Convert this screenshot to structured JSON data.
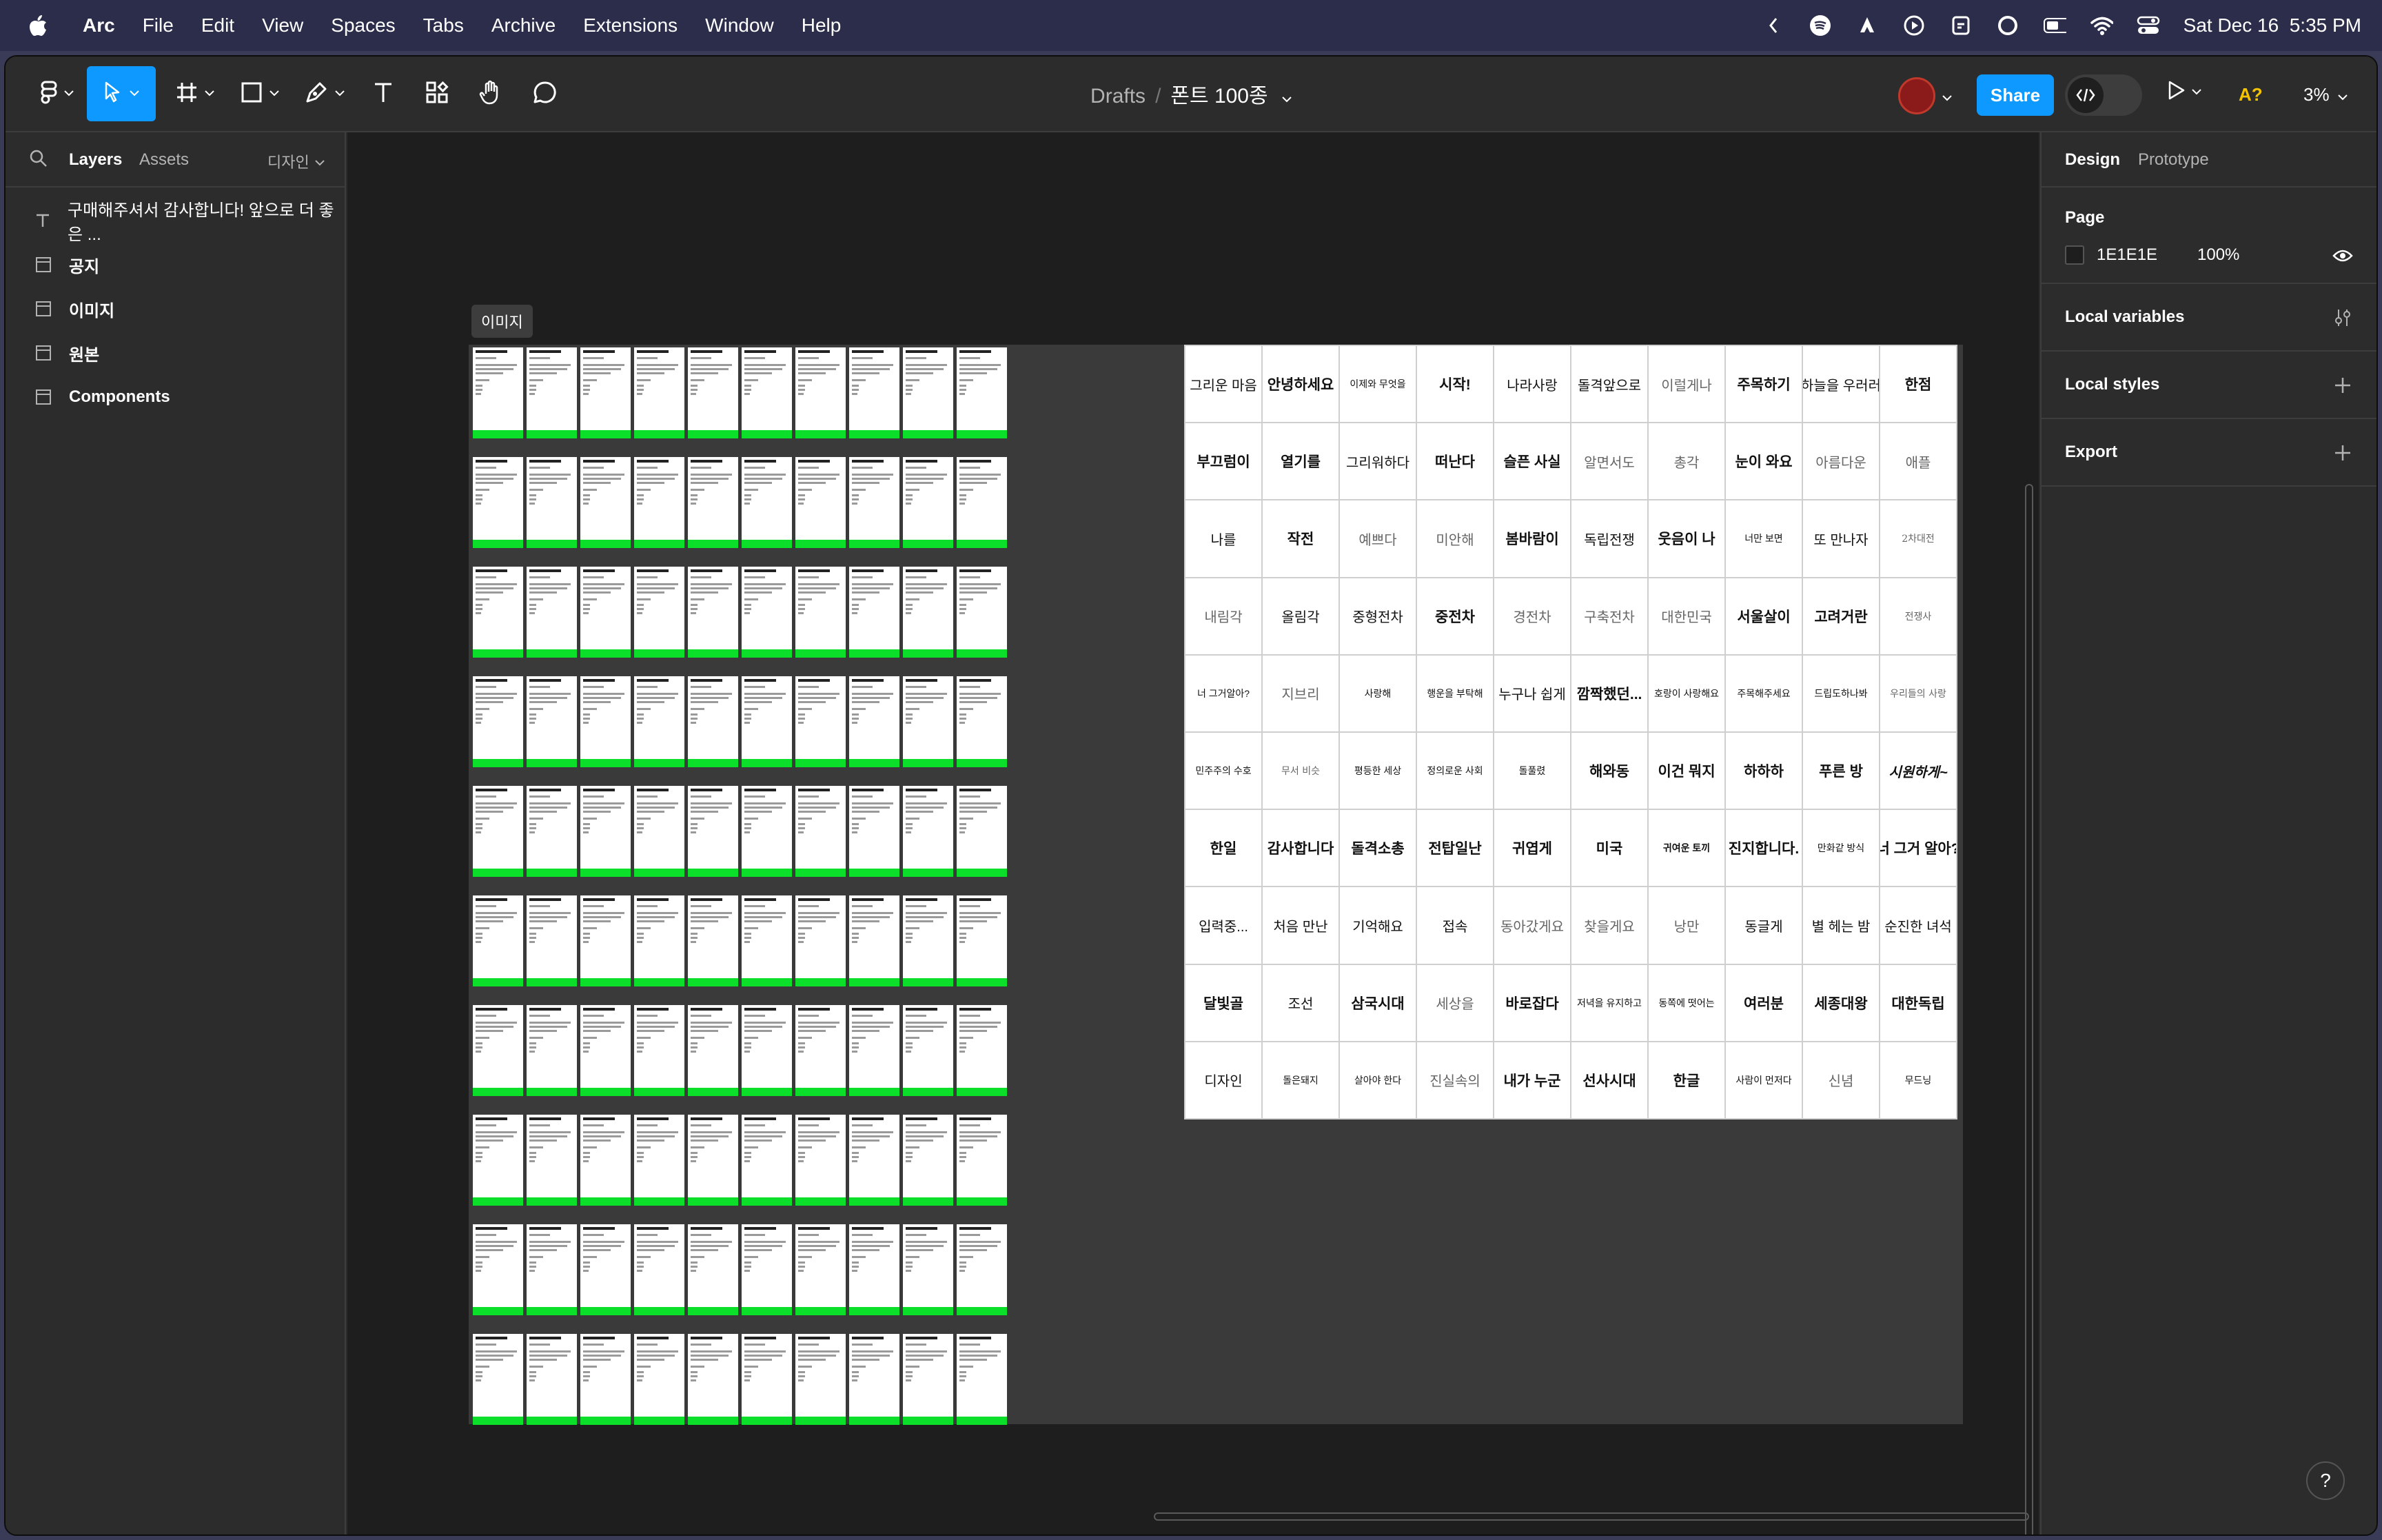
{
  "menubar": {
    "app_name": "Arc",
    "items": [
      "File",
      "Edit",
      "View",
      "Spaces",
      "Tabs",
      "Archive",
      "Extensions",
      "Window",
      "Help"
    ],
    "datetime": "Sat Dec 16  5:35 PM"
  },
  "toolbar": {
    "breadcrumb_root": "Drafts",
    "separator": "/",
    "file_name": "폰트 100종",
    "share_label": "Share",
    "a_badge": "A?",
    "zoom": "3%"
  },
  "left_panel": {
    "tab_layers": "Layers",
    "tab_assets": "Assets",
    "page_selector": "디자인",
    "layers": [
      {
        "label": "구매해주셔서 감사합니다! 앞으로 더 좋은 ...",
        "icon": "text-icon"
      },
      {
        "label": "공지",
        "icon": "frame-icon"
      },
      {
        "label": "이미지",
        "icon": "frame-icon"
      },
      {
        "label": "원본",
        "icon": "frame-icon"
      },
      {
        "label": "Components",
        "icon": "frame-icon"
      }
    ]
  },
  "canvas": {
    "frame_label": "이미지",
    "font_samples": [
      "그리운 마음",
      "안녕하세요",
      "이제와 무엇을",
      "시작!",
      "나라사랑",
      "돌격앞으로",
      "이럴게나",
      "주목하기",
      "하늘을 우러러",
      "한점",
      "부끄럼이",
      "열기를",
      "그리워하다",
      "떠난다",
      "슬픈 사실",
      "알면서도",
      "총각",
      "눈이 와요",
      "아름다운",
      "애플",
      "나를",
      "작전",
      "예쁘다",
      "미안해",
      "봄바람이",
      "독립전쟁",
      "웃음이 나",
      "너만 보면",
      "또 만나자",
      "2차대전",
      "내림각",
      "올림각",
      "중형전차",
      "중전차",
      "경전차",
      "구축전차",
      "대한민국",
      "서울살이",
      "고려거란",
      "전쟁사",
      "너 그거알아?",
      "지브리",
      "사랑해",
      "행운을 부탁해",
      "누구나 쉽게",
      "깜짝했던...",
      "호랑이 사랑해요",
      "주목해주세요",
      "드립도하나봐",
      "우리들의 사랑",
      "민주주의 수호",
      "무서 비슷",
      "평등한 세상",
      "정의로운 사회",
      "돌풀렸",
      "해와동",
      "이건 뭐지",
      "하하하",
      "푸른 방",
      "시원하게~",
      "한일",
      "감사합니다",
      "돌격소총",
      "전탑일난",
      "귀엽게",
      "미국",
      "귀여운 토끼",
      "진지합니다.",
      "만화같 방식",
      "너 그거 알아?",
      "입력중...",
      "처음 만난",
      "기억해요",
      "접속",
      "동아갔게요",
      "찾을게요",
      "낭만",
      "동글게",
      "별 헤는 밤",
      "순진한 녀석",
      "달빛골",
      "조선",
      "삼국시대",
      "세상을",
      "바로잡다",
      "저녁을 유지하고",
      "동쪽에 떳어는",
      "여러분",
      "세종대왕",
      "대한독립",
      "디자인",
      "돌은돼지",
      "살아야 한다",
      "진실속의",
      "내가 누군",
      "선사시대",
      "한글",
      "사람이 먼저다",
      "신념",
      "무드닝"
    ],
    "font_sample_styles": [
      "r",
      "b",
      "r s",
      "b",
      "r",
      "r",
      "l",
      "b",
      "r",
      "b",
      "b",
      "b",
      "r",
      "b",
      "b",
      "l",
      "l",
      "b",
      "l",
      "l",
      "r",
      "b",
      "l",
      "l",
      "b",
      "r",
      "b",
      "r s",
      "r",
      "l s",
      "l",
      "r",
      "r",
      "b",
      "l",
      "l",
      "l",
      "b",
      "b",
      "l s",
      "r s",
      "l",
      "r s",
      "r s",
      "r",
      "b",
      "r s",
      "r s",
      "r s",
      "l s",
      "r s",
      "l s",
      "r s",
      "r s",
      "r s",
      "b",
      "b",
      "b",
      "b",
      "i",
      "b",
      "b",
      "b",
      "b",
      "b",
      "b",
      "b s",
      "b",
      "r s",
      "b",
      "r",
      "r",
      "r",
      "r",
      "l",
      "l",
      "l",
      "r",
      "r",
      "r",
      "b",
      "r",
      "b",
      "l",
      "b",
      "r s",
      "r s",
      "b",
      "b",
      "b",
      "r",
      "r s",
      "r s",
      "l",
      "b",
      "b",
      "b",
      "r s",
      "l",
      "r s"
    ]
  },
  "right_panel": {
    "tab_design": "Design",
    "tab_prototype": "Prototype",
    "page_title": "Page",
    "page_color_hex": "1E1E1E",
    "page_opacity": "100%",
    "local_variables": "Local variables",
    "local_styles": "Local styles",
    "export": "Export",
    "help": "?"
  },
  "colors": {
    "accent": "#0d99ff",
    "canvas_bg": "#1e1e1e",
    "thumb_bar": "#0bdf2a"
  }
}
